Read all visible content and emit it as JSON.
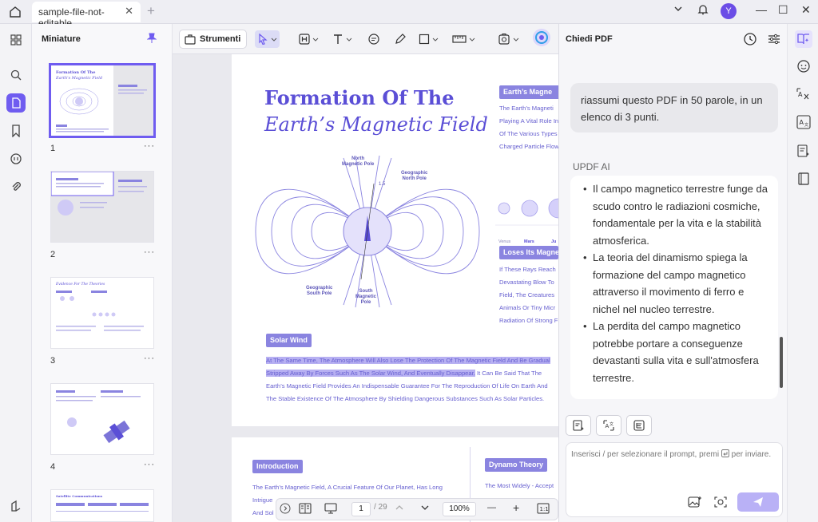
{
  "titlebar": {
    "tab_title": "sample-file-not-editable",
    "tab_close": "✕",
    "new_tab": "+",
    "avatar_initial": "Y",
    "minimize": "—",
    "maximize": "☐",
    "close": "✕"
  },
  "thumbnails": {
    "header": "Miniature",
    "pages": [
      {
        "number": "1",
        "more": "···"
      },
      {
        "number": "2",
        "more": "···"
      },
      {
        "number": "3",
        "more": "···"
      },
      {
        "number": "4",
        "more": "···"
      }
    ]
  },
  "toolbar": {
    "tools_label": "Strumenti"
  },
  "document": {
    "title_line1": "Formation Of The",
    "title_line2": "Earth’s Magnetic Field",
    "labels": {
      "north_magnetic_pole": "North\nMagnetic Pole",
      "geographic_north_pole": "Geographic\nNorth Pole",
      "geographic_south_pole": "Geographic\nSouth Pole",
      "south_magnetic_pole": "South\nMagnetic\nPole",
      "angle": "1.5"
    },
    "right_heading1": "Earth’s Magne",
    "right_text1": [
      "The Earth’s Magneti",
      "Playing A Vital Role In",
      "Of The Various Types",
      "Charged Particle Flow"
    ],
    "planets": [
      "Venus",
      "Mars",
      "Ju"
    ],
    "right_heading2": "Loses Its Magne",
    "right_text2": [
      "If These Rays Reach",
      "Devastating Blow To",
      "Field, The Creatures",
      "Animals Or Tiny Micr",
      "Radiation Of Strong F"
    ],
    "solar_wind_heading": "Solar Wind",
    "solar_wind_lines": [
      {
        "hl": "At The Same Time, The Atmosphere Will Also Lose The Protection Of The Magnetic Field And Be Gradual",
        "rest": ""
      },
      {
        "hl": "Stripped Away By Forces Such As The Solar Wind, And Eventually Disappear.",
        "rest": " It Can Be Said That The"
      },
      {
        "hl": "",
        "rest": "Earth’s Magnetic Field Provides An Indispensable Guarantee For The Reproduction Of Life On Earth And"
      },
      {
        "hl": "",
        "rest": "The Stable Existence Of The Atmosphere By Shielding Dangerous Substances Such As Solar Particles."
      }
    ],
    "page2": {
      "intro_heading": "Introduction",
      "intro_lines": [
        "The Earth’s Magnetic Field, A Crucial Feature Of Our Planet, Has Long",
        "Intrigue",
        "And Sol"
      ],
      "dynamo_heading": "Dynamo Theory",
      "dynamo_line": "The Most Widely - Accept"
    }
  },
  "navbar": {
    "page_current": "1",
    "page_total": "/ 29",
    "zoom": "100%",
    "zoom_out": "—",
    "zoom_in": "+"
  },
  "chat": {
    "title": "Chiedi PDF",
    "user_message": "riassumi questo PDF in 50 parole, in un elenco di 3 punti.",
    "ai_label": "UPDF AI",
    "ai_points": [
      "Il campo magnetico terrestre funge da scudo contro le radiazioni cosmiche, fondamentale per la vita e la stabilità atmosferica.",
      "La teoria del dinamismo spiega la formazione del campo magnetico attraverso il movimento di ferro e nichel nel nucleo terrestre.",
      "La perdita del campo magnetico potrebbe portare a conseguenze devastanti sulla vita e sull'atmosfera terrestre."
    ],
    "input_placeholder_before": "Inserisci / per selezionare il prompt, premi",
    "input_placeholder_after": "per inviare."
  },
  "colors": {
    "accent": "#6f5cf0",
    "doc_purple": "#5b4fd6",
    "chip": "#8a84e0",
    "highlight": "#b7b0f2"
  }
}
